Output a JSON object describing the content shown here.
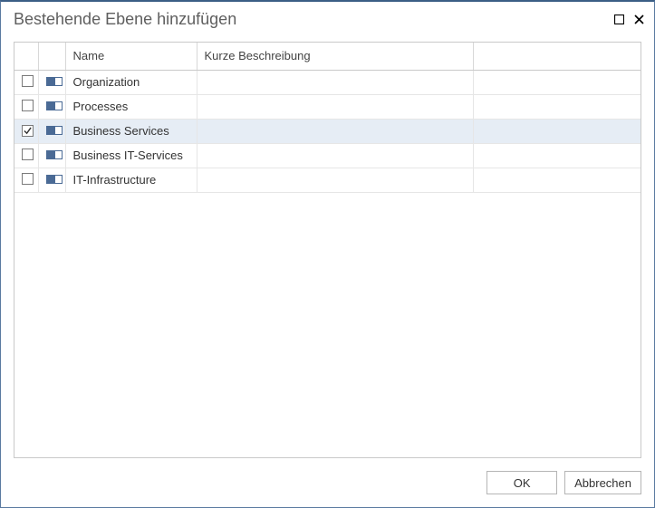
{
  "title": "Bestehende Ebene hinzufügen",
  "columns": {
    "name": "Name",
    "description": "Kurze Beschreibung"
  },
  "rows": [
    {
      "checked": false,
      "name": "Organization",
      "description": ""
    },
    {
      "checked": false,
      "name": "Processes",
      "description": ""
    },
    {
      "checked": true,
      "name": "Business Services",
      "description": "",
      "selected": true
    },
    {
      "checked": false,
      "name": "Business IT-Services",
      "description": ""
    },
    {
      "checked": false,
      "name": "IT-Infrastructure",
      "description": ""
    }
  ],
  "buttons": {
    "ok": "OK",
    "cancel": "Abbrechen"
  }
}
